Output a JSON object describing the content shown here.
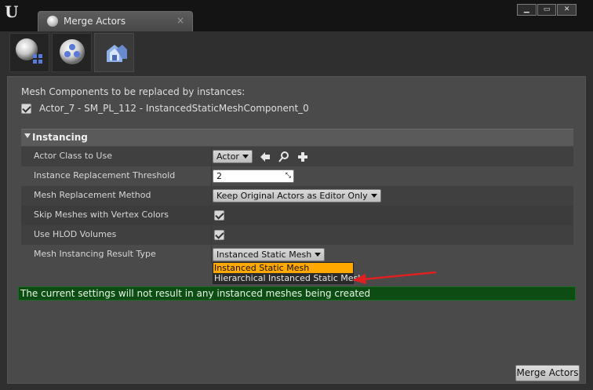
{
  "window": {
    "tab_title": "Merge Actors",
    "tab_close": "×",
    "logo": "U",
    "controls": [
      "▁",
      "▭",
      "✕"
    ]
  },
  "mode_tabs": [
    {
      "name": "merge-mesh-mode-icon",
      "active": false
    },
    {
      "name": "proxy-mesh-mode-icon",
      "active": false
    },
    {
      "name": "instancing-mode-icon",
      "active": true
    }
  ],
  "intro_text": "Mesh Components to be replaced by instances:",
  "component": {
    "checked": true,
    "label": "Actor_7 - SM_PL_112 - InstancedStaticMeshComponent_0"
  },
  "section": {
    "title": "Instancing"
  },
  "properties": {
    "actor_class": {
      "label": "Actor Class to Use",
      "value": "Actor"
    },
    "threshold": {
      "label": "Instance Replacement Threshold",
      "value": "2"
    },
    "replacement_method": {
      "label": "Mesh Replacement Method",
      "value": "Keep Original Actors as Editor Only"
    },
    "skip_vertex_colors": {
      "label": "Skip Meshes with Vertex Colors",
      "checked": true
    },
    "use_hlod": {
      "label": "Use HLOD Volumes",
      "checked": true
    },
    "result_type": {
      "label": "Mesh Instancing Result Type",
      "value": "Instanced Static Mesh"
    }
  },
  "dropdown_options": [
    "Instanced Static Mesh",
    "Hierarchical Instanced Static Mesh"
  ],
  "dropdown_selected_index": 0,
  "warning": "The current settings will not result in any instanced meshes being created",
  "merge_button": "Merge Actors",
  "colors": {
    "panel": "#4a4a4a",
    "selected_option": "#ffa800",
    "warning_bg": "#0d4d14",
    "annotation_arrow": "#e02020"
  }
}
